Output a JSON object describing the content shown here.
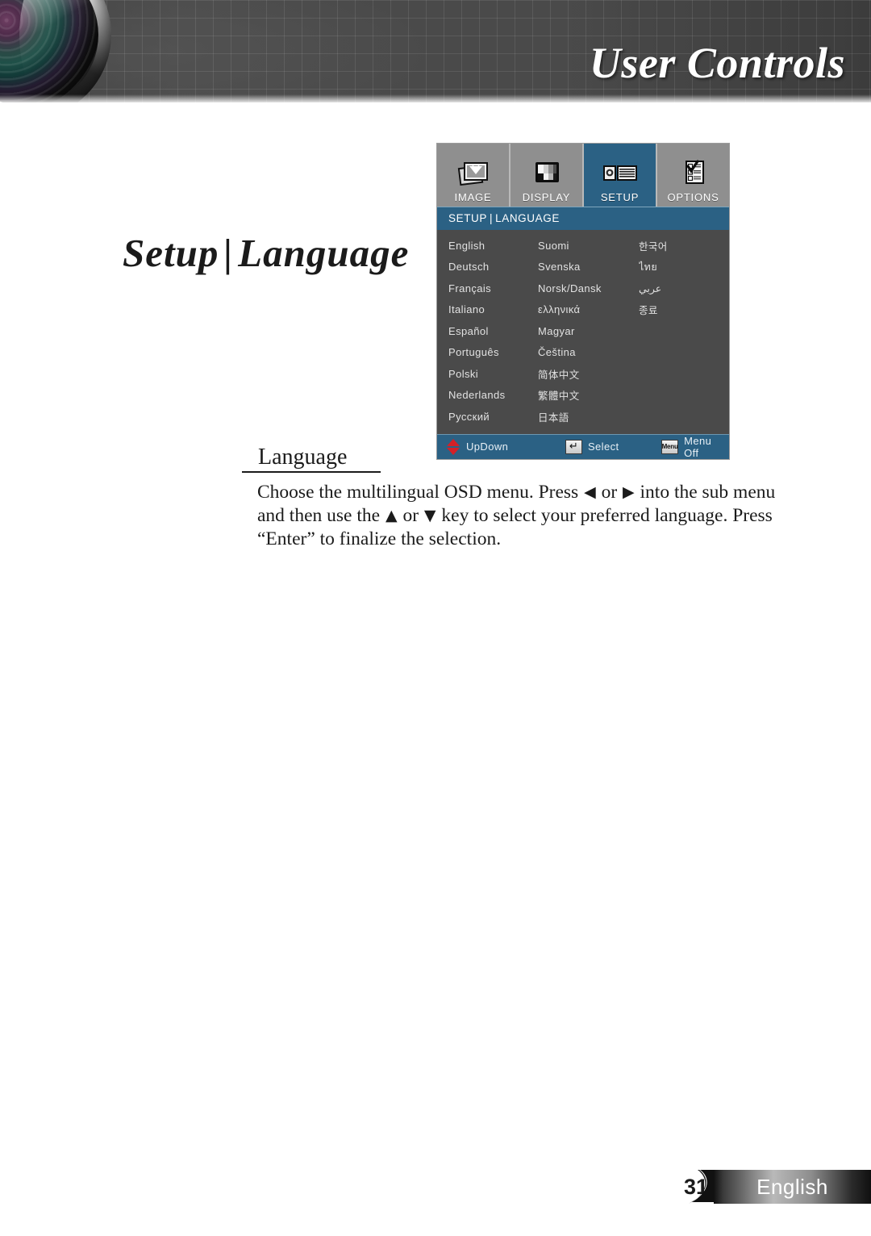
{
  "header": {
    "title": "User Controls",
    "lens_icon": "projector-lens-photo"
  },
  "page_title": {
    "left": "Setup",
    "separator": "|",
    "right": "Language"
  },
  "osd": {
    "tabs": [
      {
        "label": "IMAGE",
        "icon": "image-stack-icon",
        "active": false
      },
      {
        "label": "DISPLAY",
        "icon": "test-pattern-icon",
        "active": false
      },
      {
        "label": "SETUP",
        "icon": "projector-icon",
        "active": true
      },
      {
        "label": "OPTIONS",
        "icon": "checklist-icon",
        "active": false
      }
    ],
    "subheader": {
      "parent": "SETUP",
      "separator": "|",
      "current": "LANGUAGE"
    },
    "language_rows": [
      {
        "col1": "English",
        "col2": "Suomi",
        "col3": "한국어"
      },
      {
        "col1": "Deutsch",
        "col2": "Svenska",
        "col3": "ไทย"
      },
      {
        "col1": "Français",
        "col2": "Norsk/Dansk",
        "col3": "عربي"
      },
      {
        "col1": "Italiano",
        "col2": "ελληνικά",
        "col3": "종료"
      },
      {
        "col1": "Español",
        "col2": "Magyar",
        "col3": ""
      },
      {
        "col1": "Português",
        "col2": "Čeština",
        "col3": ""
      },
      {
        "col1": "Polski",
        "col2": "简体中文",
        "col3": ""
      },
      {
        "col1": "Nederlands",
        "col2": "繁體中文",
        "col3": ""
      },
      {
        "col1": "Русский",
        "col2": "日本語",
        "col3": ""
      }
    ],
    "footer": [
      {
        "label": "UpDown",
        "icon": "up-down-arrows-icon",
        "glyph": ""
      },
      {
        "label": "Select",
        "icon": "enter-key-icon",
        "glyph": "↵"
      },
      {
        "label": "Menu Off",
        "icon": "menu-key-icon",
        "glyph": "Menu"
      }
    ]
  },
  "section": {
    "heading": "Language",
    "body_parts": {
      "p1": "Choose the multilingual OSD menu. Press ",
      "left_glyph": "◀",
      "p2": " or ",
      "right_glyph": "▶",
      "p3": " into the sub menu and then use the ",
      "up_glyph": "▲",
      "p4": " or ",
      "down_glyph": "▼",
      "p5": " key to select your preferred language. Press “Enter” to finalize the selection."
    }
  },
  "footer": {
    "page_number": "31",
    "language_tab": "English"
  },
  "colors": {
    "osd_accent": "#2b6184",
    "osd_body": "#4a4a4a",
    "osd_tabbar": "#8f8f8f",
    "header_bg": "#4b4b4b",
    "updown_red": "#d42027",
    "text_dark": "#1b1b1b"
  }
}
